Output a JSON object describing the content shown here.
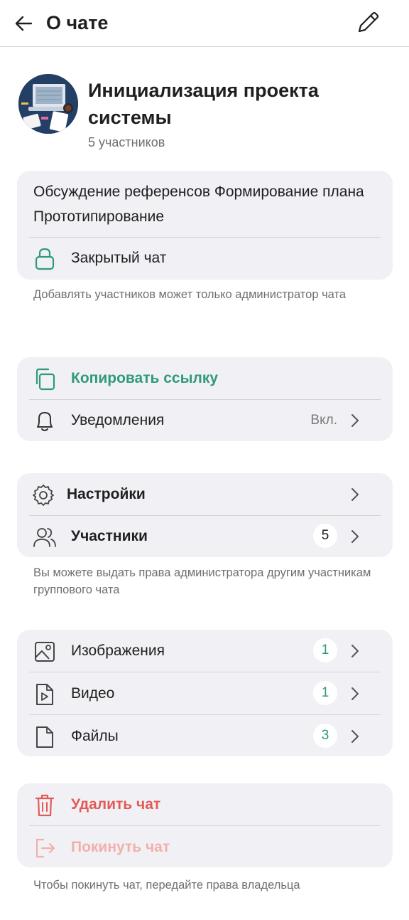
{
  "header": {
    "title": "О чате"
  },
  "chat": {
    "name": "Инициализация проекта системы",
    "members_count_label": "5 участников",
    "description": "Обсуждение референсов Формирование плана Прототипирование",
    "closed_label": "Закрытый чат",
    "closed_note": "Добавлять участников может только администратор чата"
  },
  "actions": {
    "copy_link": "Копировать ссылку",
    "notifications": "Уведомления",
    "notifications_value": "Вкл."
  },
  "manage": {
    "settings": "Настройки",
    "members": "Участники",
    "members_count": "5",
    "note": "Вы можете выдать права администратора другим участникам группового чата"
  },
  "media": {
    "images": "Изображения",
    "images_count": "1",
    "video": "Видео",
    "video_count": "1",
    "files": "Файлы",
    "files_count": "3"
  },
  "danger": {
    "delete": "Удалить чат",
    "leave": "Покинуть чат",
    "note": "Чтобы покинуть чат, передайте права владельца"
  },
  "colors": {
    "accent": "#2f9a78",
    "danger": "#e25a55",
    "danger_disabled": "#f2b0aa",
    "card_bg": "#f1f1f5"
  }
}
